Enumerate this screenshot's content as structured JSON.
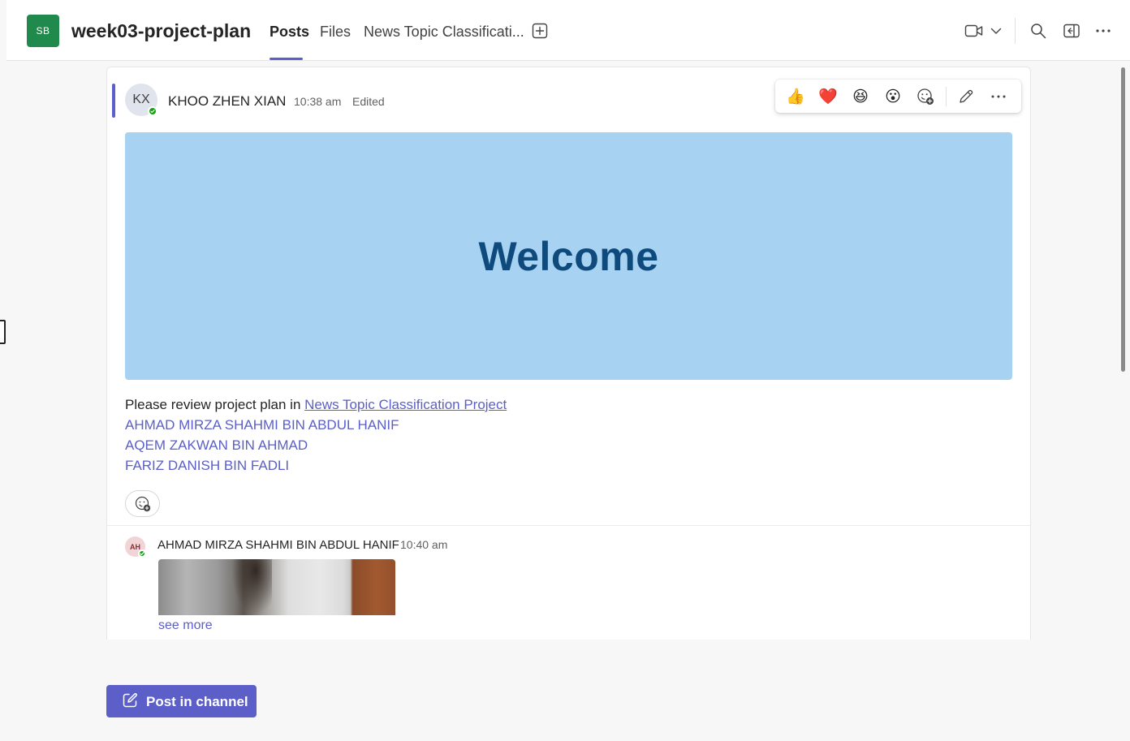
{
  "header": {
    "team_initials": "SB",
    "channel_title": "week03-project-plan",
    "tabs": [
      {
        "label": "Posts",
        "active": true
      },
      {
        "label": "Files",
        "active": false
      },
      {
        "label": "News Topic Classificati...",
        "active": false
      }
    ],
    "icons": [
      "add-tab-icon",
      "video-camera-icon",
      "chevron-down-icon",
      "search-icon",
      "side-panel-icon",
      "more-options-icon"
    ]
  },
  "post": {
    "author_initials": "KX",
    "author": "KHOO ZHEN XIAN",
    "time": "10:38 am",
    "edited": "Edited",
    "reactions": [
      "👍",
      "❤️",
      "😆",
      "😮"
    ],
    "banner_text": "Welcome",
    "body_prefix": "Please review project plan in ",
    "link_text": "News Topic Classification Project",
    "mentions": [
      "AHMAD MIRZA SHAHMI BIN ABDUL HANIF",
      "AQEM ZAKWAN BIN AHMAD",
      "FARIZ DANISH BIN FADLI"
    ]
  },
  "reply": {
    "author_initials": "AH",
    "author": "AHMAD MIRZA SHAHMI BIN ABDUL HANIF",
    "time": "10:40 am",
    "see_more": "see more"
  },
  "compose": {
    "post_button_label": "Post in channel"
  },
  "colors": {
    "accent": "#5b5fc7",
    "team_avatar": "#1f8a4c",
    "banner_bg": "#a7d2f2",
    "banner_text": "#0f4a7d",
    "presence": "#13a10e"
  }
}
